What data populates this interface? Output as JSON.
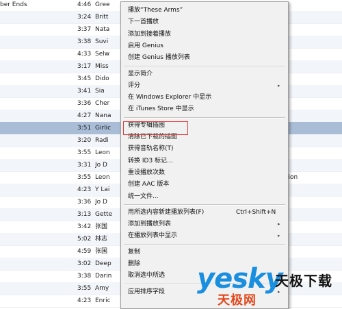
{
  "song_list": {
    "rows": [
      {
        "name": "ber Ends",
        "time": "4:46",
        "artist": "Gree",
        "extra": ""
      },
      {
        "name": "",
        "time": "3:24",
        "artist": "Britt",
        "extra": ""
      },
      {
        "name": "",
        "time": "3:37",
        "artist": "Nata",
        "extra": ""
      },
      {
        "name": "",
        "time": "3:38",
        "artist": "Suvi",
        "extra": ""
      },
      {
        "name": "",
        "time": "4:33",
        "artist": "Selw",
        "extra": ""
      },
      {
        "name": "",
        "time": "3:17",
        "artist": "Miss",
        "extra": ""
      },
      {
        "name": "",
        "time": "3:45",
        "artist": "Dido",
        "extra": ""
      },
      {
        "name": "",
        "time": "3:41",
        "artist": "Sia",
        "extra": ""
      },
      {
        "name": "",
        "time": "3:36",
        "artist": "Cher",
        "extra": ""
      },
      {
        "name": "",
        "time": "4:27",
        "artist": "Nana",
        "extra": ""
      },
      {
        "name": "",
        "time": "3:51",
        "artist": "Girlic",
        "extra": ""
      },
      {
        "name": "",
        "time": "3:20",
        "artist": "Radi",
        "extra": ""
      },
      {
        "name": "",
        "time": "3:55",
        "artist": "Leon",
        "extra": ""
      },
      {
        "name": "",
        "time": "3:31",
        "artist": "Jo D",
        "extra": ""
      },
      {
        "name": "",
        "time": "3:55",
        "artist": "Leon",
        "extra": "tion"
      },
      {
        "name": "",
        "time": "4:23",
        "artist": "Y Lai",
        "extra": ""
      },
      {
        "name": "",
        "time": "3:36",
        "artist": "Jo D",
        "extra": ""
      },
      {
        "name": "",
        "time": "3:13",
        "artist": "Gette",
        "extra": ""
      },
      {
        "name": "",
        "time": "3:42",
        "artist": "张国",
        "extra": ""
      },
      {
        "name": "",
        "time": "5:02",
        "artist": "林志",
        "extra": ""
      },
      {
        "name": "",
        "time": "4:59",
        "artist": "张国",
        "extra": ""
      },
      {
        "name": "",
        "time": "3:02",
        "artist": "Deep",
        "extra": ""
      },
      {
        "name": "",
        "time": "3:38",
        "artist": "Darin",
        "extra": ""
      },
      {
        "name": "",
        "time": "3:55",
        "artist": "Amy",
        "extra": ""
      },
      {
        "name": "",
        "time": "4:23",
        "artist": "Enric",
        "extra": ""
      }
    ],
    "selected_index": 10
  },
  "context_menu": {
    "items": [
      {
        "label": "播放“These Arms”",
        "shortcut": "",
        "submenu": false
      },
      {
        "label": "下一首播放",
        "shortcut": "",
        "submenu": false
      },
      {
        "label": "添加到接着播放",
        "shortcut": "",
        "submenu": false
      },
      {
        "label": "启用 Genius",
        "shortcut": "",
        "submenu": false
      },
      {
        "label": "创建 Genius 播放列表",
        "shortcut": "",
        "submenu": false
      },
      {
        "label": "显示简介",
        "shortcut": "",
        "submenu": false
      },
      {
        "label": "评分",
        "shortcut": "",
        "submenu": true
      },
      {
        "label": "在 Windows Explorer 中显示",
        "shortcut": "",
        "submenu": false
      },
      {
        "label": "在 iTunes Store 中显示",
        "shortcut": "",
        "submenu": false
      },
      {
        "label": "获得专辑插图",
        "shortcut": "",
        "submenu": false
      },
      {
        "label": "清除已下载的插图",
        "shortcut": "",
        "submenu": false
      },
      {
        "label": "获得音轨名称(T)",
        "shortcut": "",
        "submenu": false
      },
      {
        "label": "转换 ID3 标记...",
        "shortcut": "",
        "submenu": false
      },
      {
        "label": "重设播放次数",
        "shortcut": "",
        "submenu": false
      },
      {
        "label": "创建 AAC 版本",
        "shortcut": "",
        "submenu": false
      },
      {
        "label": "统一文件...",
        "shortcut": "",
        "submenu": false
      },
      {
        "label": "用所选内容新建播放列表(F)",
        "shortcut": "Ctrl+Shift+N",
        "submenu": false
      },
      {
        "label": "添加到播放列表",
        "shortcut": "",
        "submenu": true
      },
      {
        "label": "在播放列表中显示",
        "shortcut": "",
        "submenu": true
      },
      {
        "label": "复制",
        "shortcut": "",
        "submenu": false
      },
      {
        "label": "删除",
        "shortcut": "",
        "submenu": false
      },
      {
        "label": "取消选中所选",
        "shortcut": "",
        "submenu": false
      },
      {
        "label": "应用排序字段",
        "shortcut": "",
        "submenu": true
      }
    ],
    "highlighted_label": "获得专辑插图",
    "submenu_arrow": "▸"
  },
  "watermark": {
    "brand": "yesky",
    "name_cn": "天极下载",
    "sub_cn": "天极网"
  },
  "colors": {
    "selected_row": "#a9bdd7",
    "highlight_border": "#e33b3b",
    "logo_blue": "#1a8fe0",
    "logo_red": "#e2481c"
  }
}
